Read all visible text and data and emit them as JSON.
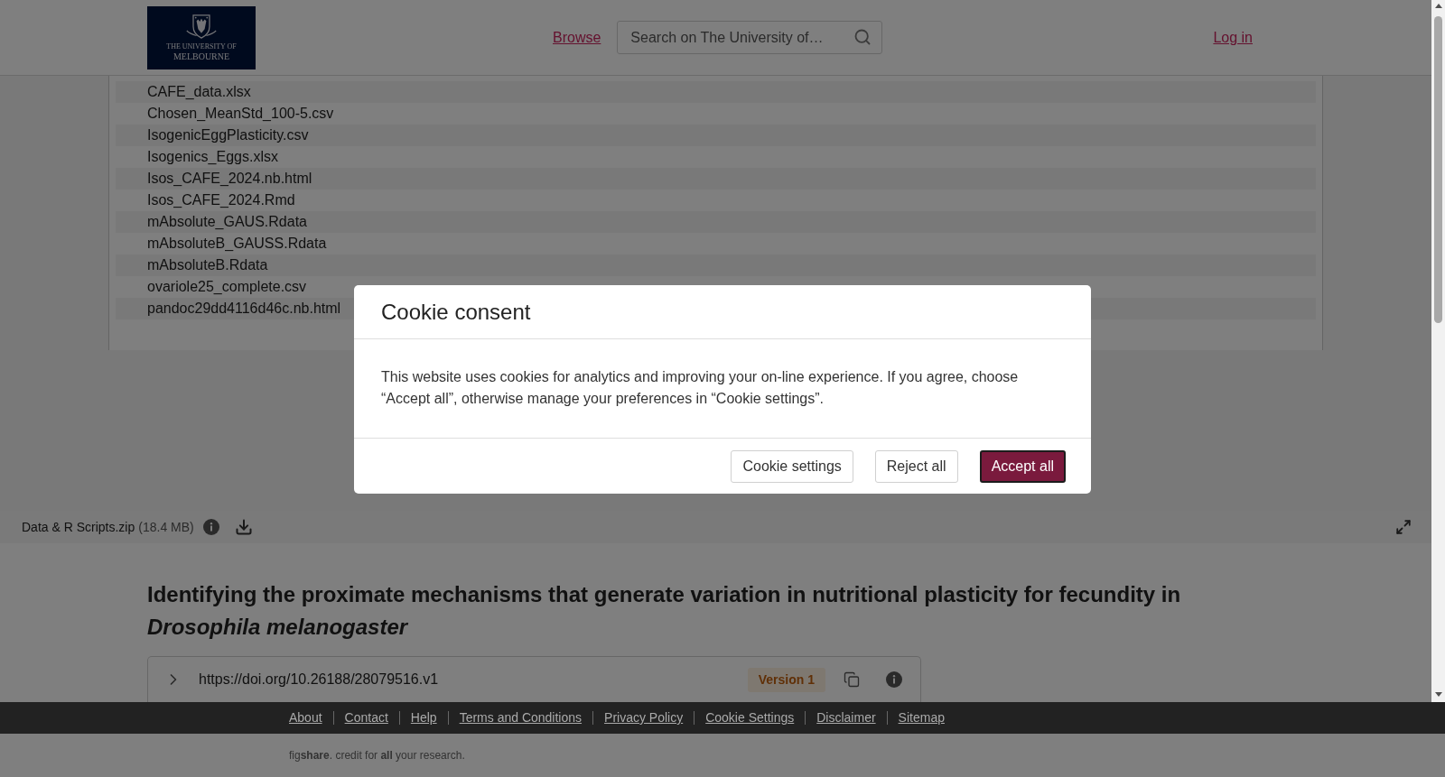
{
  "header": {
    "logo": {
      "line_1": "THE UNIVERSITY OF",
      "line_2": "MELBOURNE"
    },
    "nav_link": "Browse",
    "search": {
      "placeholder": "Search on The University of…"
    },
    "login_link": "Log in"
  },
  "preview": {
    "files": [
      "CAFE_data.xlsx",
      "Chosen_MeanStd_100-5.csv",
      "IsogenicEggPlasticity.csv",
      "Isogenics_Eggs.xlsx",
      "Isos_CAFE_2024.nb.html",
      "Isos_CAFE_2024.Rmd",
      "mAbsolute_GAUS.Rdata",
      "mAbsoluteB_GAUSS.Rdata",
      "mAbsoluteB.Rdata",
      "ovariole25_complete.csv",
      "pandoc29dd4116d46c.nb.html"
    ]
  },
  "file_bar": {
    "name": "Data & R Scripts.zip",
    "size": "(18.4 MB)"
  },
  "item": {
    "title": "Identifying the proximate mechanisms that generate variation in nutritional plasticity for fecundity in *Drosophila melanogaster*",
    "doi": "https://doi.org/10.26188/28079516.v1",
    "version_badge": "Version 1"
  },
  "footer": {
    "links": [
      "About",
      "Contact",
      "Help",
      "Terms and Conditions",
      "Privacy Policy",
      "Cookie Settings",
      "Disclaimer",
      "Sitemap"
    ],
    "tagline": "fig**share**. credit for **all** your research."
  },
  "cookie_dialog": {
    "title": "Cookie consent",
    "message": "This website uses cookies for analytics and improving your on-line experience. If you agree, choose “Accept all”, otherwise manage your preferences in “Cookie settings”.",
    "buttons": [
      {
        "label": "Cookie settings",
        "kind": "secondary",
        "focused": false
      },
      {
        "label": "Reject all",
        "kind": "secondary",
        "focused": false
      },
      {
        "label": "Accept all",
        "kind": "primary",
        "focused": true
      }
    ]
  }
}
